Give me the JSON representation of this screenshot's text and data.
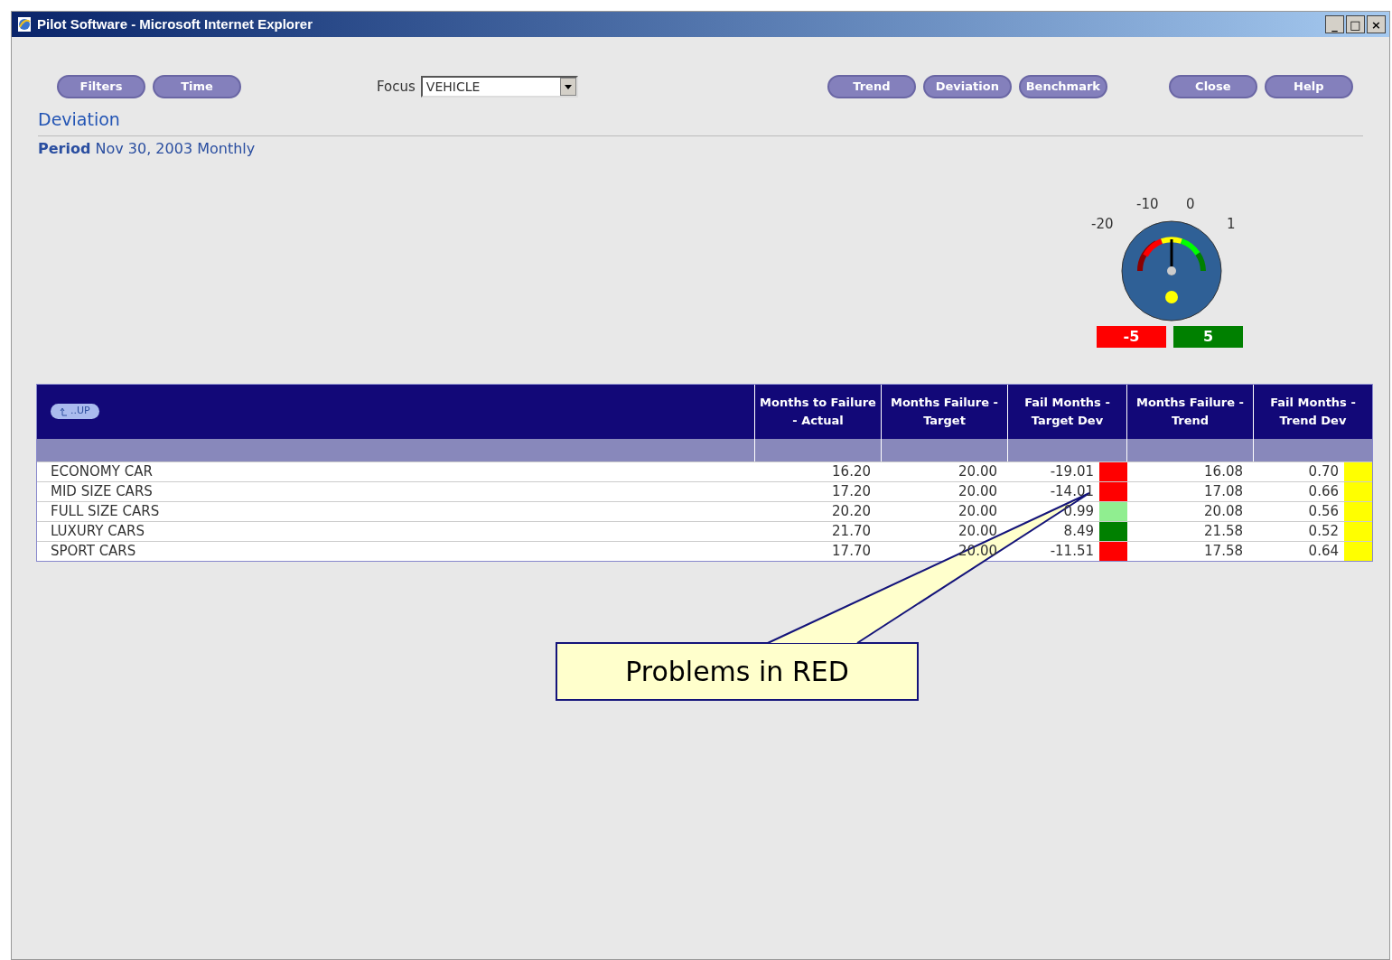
{
  "window": {
    "title": "Pilot Software - Microsoft Internet Explorer",
    "controls": [
      "_",
      "□",
      "×"
    ]
  },
  "toolbar": {
    "left_buttons": [
      "Filters",
      "Time"
    ],
    "focus": {
      "label": "Focus",
      "value": "VEHICLE"
    },
    "view_buttons": [
      "Trend",
      "Deviation",
      "Benchmark"
    ],
    "right_buttons": [
      "Close",
      "Help"
    ]
  },
  "heading": "Deviation",
  "period": {
    "label": "Period",
    "value": "Nov 30, 2003 Monthly"
  },
  "gauge": {
    "scale_labels": [
      "-20",
      "-10",
      "0",
      "1"
    ],
    "low": "-5",
    "high": "5"
  },
  "table": {
    "up_button": "..UP",
    "columns": [
      "Months to Failure - Actual",
      "Months Failure - Target",
      "Fail Months - Target Dev",
      "Months Failure - Trend",
      "Fail Months - Trend Dev"
    ],
    "rows": [
      {
        "name": "ECONOMY CAR",
        "actual": "16.20",
        "target": "20.00",
        "target_dev": {
          "text": "-19.01",
          "color": "#ff0000"
        },
        "trend": "16.08",
        "trend_dev": {
          "text": "0.70",
          "color": "#ffff00"
        }
      },
      {
        "name": "MID SIZE CARS",
        "actual": "17.20",
        "target": "20.00",
        "target_dev": {
          "text": "-14.01",
          "color": "#ff0000"
        },
        "trend": "17.08",
        "trend_dev": {
          "text": "0.66",
          "color": "#ffff00"
        }
      },
      {
        "name": "FULL SIZE CARS",
        "actual": "20.20",
        "target": "20.00",
        "target_dev": {
          "text": "0.99",
          "color": "#90ee90"
        },
        "trend": "20.08",
        "trend_dev": {
          "text": "0.56",
          "color": "#ffff00"
        }
      },
      {
        "name": "LUXURY CARS",
        "actual": "21.70",
        "target": "20.00",
        "target_dev": {
          "text": "8.49",
          "color": "#008000"
        },
        "trend": "21.58",
        "trend_dev": {
          "text": "0.52",
          "color": "#ffff00"
        }
      },
      {
        "name": "SPORT CARS",
        "actual": "17.70",
        "target": "20.00",
        "target_dev": {
          "text": "-11.51",
          "color": "#ff0000"
        },
        "trend": "17.58",
        "trend_dev": {
          "text": "0.64",
          "color": "#ffff00"
        }
      }
    ]
  },
  "callout": "Problems in RED"
}
